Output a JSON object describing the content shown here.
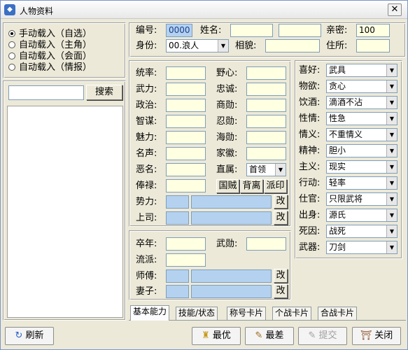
{
  "window": {
    "title": "人物资料",
    "close": "✕"
  },
  "load_options": [
    {
      "label": "手动载入（自选）",
      "selected": true
    },
    {
      "label": "自动载入（主角）",
      "selected": false
    },
    {
      "label": "自动载入（会面）",
      "selected": false
    },
    {
      "label": "自动载入（情报）",
      "selected": false
    }
  ],
  "search": {
    "value": "",
    "button": "搜索"
  },
  "header": {
    "id_label": "编号:",
    "id_value": "0000",
    "name_label": "姓名:",
    "surname_value": "",
    "given_name_value": "",
    "intimacy_label": "亲密:",
    "intimacy_value": "100",
    "identity_label": "身份:",
    "identity_value": "00.浪人",
    "appearance_label": "相貌:",
    "appearance_value": "",
    "residence_label": "住所:",
    "residence_value": ""
  },
  "stats": [
    {
      "label": "统率:",
      "value": ""
    },
    {
      "label": "武力:",
      "value": ""
    },
    {
      "label": "政治:",
      "value": ""
    },
    {
      "label": "智谋:",
      "value": ""
    },
    {
      "label": "魅力:",
      "value": ""
    },
    {
      "label": "名声:",
      "value": ""
    },
    {
      "label": "恶名:",
      "value": ""
    },
    {
      "label": "俸禄:",
      "value": ""
    }
  ],
  "stats2": [
    {
      "label": "野心:",
      "value": ""
    },
    {
      "label": "忠诚:",
      "value": ""
    },
    {
      "label": "商勋:",
      "value": ""
    },
    {
      "label": "忍勋:",
      "value": ""
    },
    {
      "label": "海勋:",
      "value": ""
    },
    {
      "label": "家徽:",
      "value": ""
    }
  ],
  "affiliation": {
    "label": "直属:",
    "value": "首领"
  },
  "action_buttons": [
    "国贼",
    "背离",
    "派印"
  ],
  "force": {
    "label": "势力:",
    "change": "改"
  },
  "superior": {
    "label": "上司:",
    "change": "改"
  },
  "life": {
    "death_year_label": "卒年:",
    "martial_label": "武勋:",
    "school_label": "流派:",
    "master_label": "师傅:",
    "spouse_label": "妻子:",
    "change": "改"
  },
  "traits": [
    {
      "label": "喜好:",
      "value": "武具"
    },
    {
      "label": "物欲:",
      "value": "贪心"
    },
    {
      "label": "饮酒:",
      "value": "滴酒不沾"
    },
    {
      "label": "性情:",
      "value": "性急"
    },
    {
      "label": "情义:",
      "value": "不重情义"
    },
    {
      "label": "精神:",
      "value": "胆小"
    },
    {
      "label": "主义:",
      "value": "现实"
    },
    {
      "label": "行动:",
      "value": "轻率"
    },
    {
      "label": "仕官:",
      "value": "只限武将"
    },
    {
      "label": "出身:",
      "value": "源氏"
    },
    {
      "label": "死因:",
      "value": "战死"
    },
    {
      "label": "武器:",
      "value": "刀剑"
    }
  ],
  "tabs": [
    "基本能力",
    "技能/状态",
    "称号卡片",
    "个战卡片",
    "合战卡片"
  ],
  "bottom": {
    "refresh": "刷新",
    "best": "最优",
    "worst": "最差",
    "submit": "提交",
    "close": "关闭"
  }
}
